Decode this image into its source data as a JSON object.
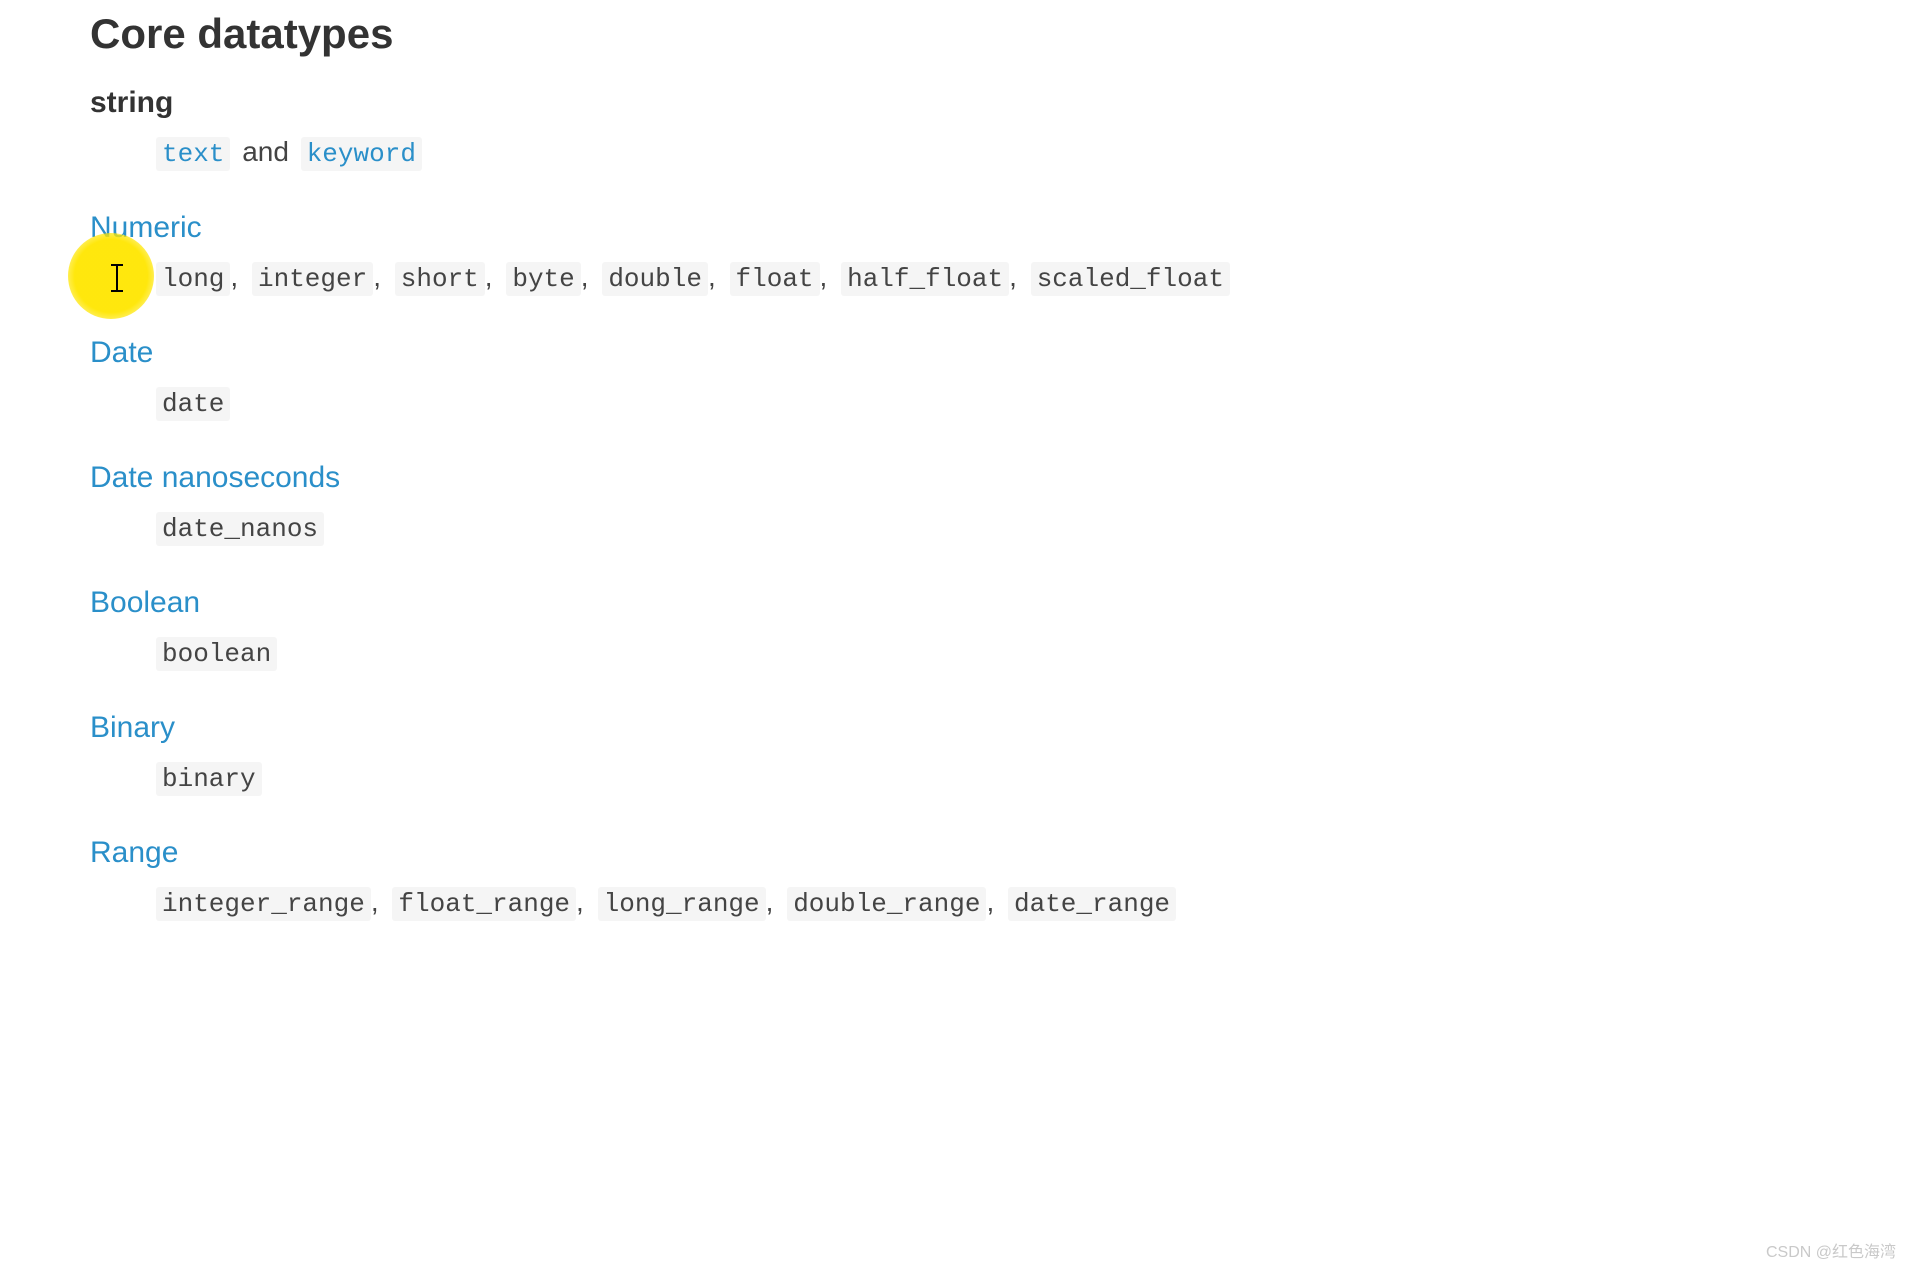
{
  "title": "Core datatypes",
  "sections": {
    "string": {
      "heading": "string",
      "codes": [
        "text",
        "keyword"
      ],
      "connector": "and"
    },
    "numeric": {
      "heading": "Numeric",
      "codes": [
        "long",
        "integer",
        "short",
        "byte",
        "double",
        "float",
        "half_float",
        "scaled_float"
      ]
    },
    "date": {
      "heading": "Date",
      "codes": [
        "date"
      ]
    },
    "date_nanos": {
      "heading": "Date nanoseconds",
      "codes": [
        "date_nanos"
      ]
    },
    "boolean": {
      "heading": "Boolean",
      "codes": [
        "boolean"
      ]
    },
    "binary": {
      "heading": "Binary",
      "codes": [
        "binary"
      ]
    },
    "range": {
      "heading": "Range",
      "codes": [
        "integer_range",
        "float_range",
        "long_range",
        "double_range",
        "date_range"
      ]
    }
  },
  "watermark": "CSDN @红色海湾"
}
